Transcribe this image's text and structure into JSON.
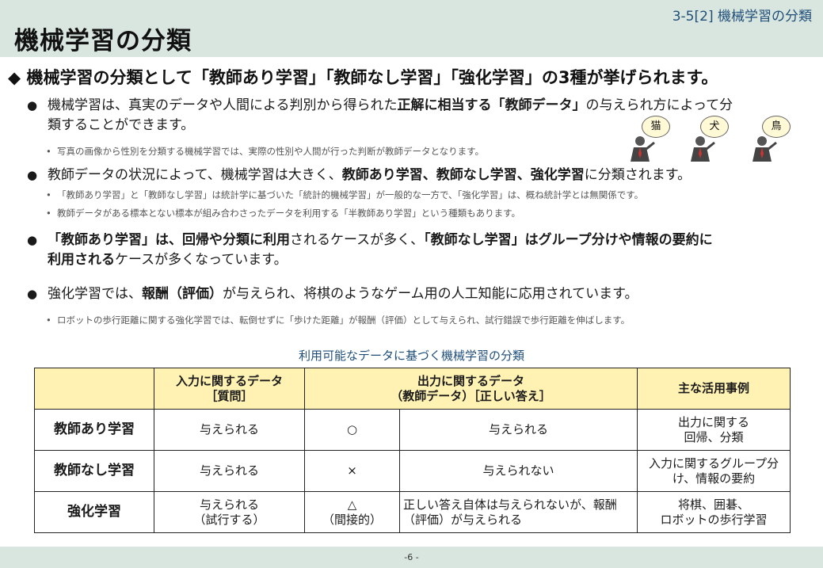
{
  "header": {
    "section_label": "3-5[2] 機械学習の分類",
    "title": "機械学習の分類"
  },
  "lead": "◆ 機械学習の分類として「教師あり学習」「教師なし学習」「強化学習」の3種が挙げられます。",
  "bullets": [
    {
      "line1_pre": "機械学習は、真実のデータや人間による判別から得られた",
      "line1_bold": "正解に相当する「教師データ」",
      "line1_post": "の与えられ方によって分",
      "line2": "類することができます。",
      "subs": [
        "写真の画像から性別を分類する機械学習では、実際の性別や人間が行った判断が教師データとなります。"
      ]
    },
    {
      "line1_pre": "教師データの状況によって、機械学習は大きく、",
      "line1_bold": "教師あり学習、教師なし学習、強化学習",
      "line1_post": "に分類されます。",
      "subs": [
        "「教師あり学習」と「教師なし学習」は統計学に基づいた「統計的機械学習」が一般的な一方で、「強化学習」は、概ね統計学とは無関係です。",
        "教師データがある標本とない標本が組み合わさったデータを利用する「半教師あり学習」という種類もあります。"
      ]
    },
    {
      "line1_bold_a": "「教師あり学習」は、回帰や分類に利用",
      "line1_mid": "されるケースが多く、",
      "line1_bold_b": "「教師なし学習」はグループ分けや情報の要約に",
      "line2_bold": "利用される",
      "line2_post": "ケースが多くなっています。"
    },
    {
      "line1_pre": "強化学習では、",
      "line1_bold": "報酬（評価）",
      "line1_post": "が与えられ、将棋のようなゲーム用の人工知能に応用されています。",
      "subs": [
        "ロボットの歩行距離に関する強化学習では、転倒せずに「歩けた距離」が報酬（評価）として与えられ、試行錯誤で歩行距離を伸ばします。"
      ]
    }
  ],
  "figures": {
    "bubbles": [
      "猫",
      "犬",
      "鳥"
    ]
  },
  "table": {
    "caption": "利用可能なデータに基づく機械学習の分類",
    "headers": {
      "input_line1": "入力に関するデータ",
      "input_line2": "［質問］",
      "output_line1": "出力に関するデータ",
      "output_line2": "（教師データ）［正しい答え］",
      "usage": "主な活用事例"
    },
    "rows": [
      {
        "name": "教師あり学習",
        "input_l1": "与えられる",
        "input_l2": "",
        "mark": "○",
        "mark_l2": "",
        "output_l1": "与えられる",
        "output_l2": "",
        "usage_l1": "出力に関する",
        "usage_l2": "回帰、分類"
      },
      {
        "name": "教師なし学習",
        "input_l1": "与えられる",
        "input_l2": "",
        "mark": "×",
        "mark_l2": "",
        "output_l1": "与えられない",
        "output_l2": "",
        "usage_l1": "入力に関するグループ分",
        "usage_l2": "け、情報の要約"
      },
      {
        "name": "強化学習",
        "input_l1": "与えられる",
        "input_l2": "（試行する）",
        "mark": "△",
        "mark_l2": "（間接的）",
        "output_l1": "正しい答え自体は与えられないが、報酬",
        "output_l2": "（評価）が与えられる",
        "usage_l1": "将棋、囲碁、",
        "usage_l2": "ロボットの歩行学習"
      }
    ]
  },
  "footer": {
    "page_number": "-6 -"
  }
}
